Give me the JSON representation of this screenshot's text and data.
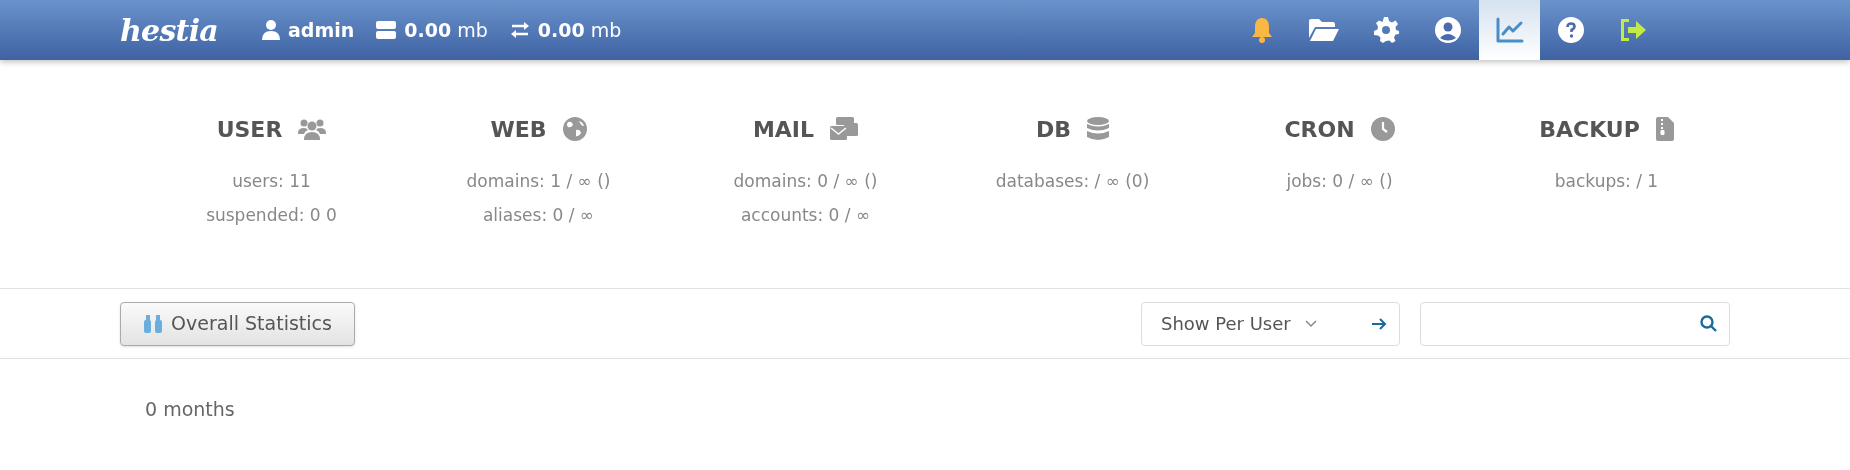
{
  "header": {
    "logo": "hestia",
    "user": "admin",
    "disk": {
      "value": "0.00",
      "unit": "mb"
    },
    "bandwidth": {
      "value": "0.00",
      "unit": "mb"
    },
    "nav": [
      {
        "kind": "bell",
        "selected": false
      },
      {
        "kind": "folder",
        "selected": false
      },
      {
        "kind": "gear",
        "selected": false
      },
      {
        "kind": "user",
        "selected": false
      },
      {
        "kind": "chart",
        "selected": true
      },
      {
        "kind": "help",
        "selected": false
      },
      {
        "kind": "logout",
        "selected": false
      }
    ]
  },
  "stats": [
    {
      "kind": "user",
      "title": "USER",
      "lines": [
        "users: 11",
        "suspended: 0 0"
      ]
    },
    {
      "kind": "web",
      "title": "WEB",
      "lines": [
        "domains: 1 / ∞ ()",
        "aliases: 0 / ∞"
      ]
    },
    {
      "kind": "mail",
      "title": "MAIL",
      "lines": [
        "domains: 0 / ∞ ()",
        "accounts: 0 / ∞"
      ]
    },
    {
      "kind": "db",
      "title": "DB",
      "lines": [
        "databases: / ∞ (0)"
      ]
    },
    {
      "kind": "cron",
      "title": "CRON",
      "lines": [
        "jobs: 0 / ∞ ()"
      ]
    },
    {
      "kind": "backup",
      "title": "BACKUP",
      "lines": [
        "backups: / 1"
      ]
    }
  ],
  "toolbar": {
    "button": "Overall Statistics",
    "select": "Show Per User"
  },
  "content": "0 months"
}
